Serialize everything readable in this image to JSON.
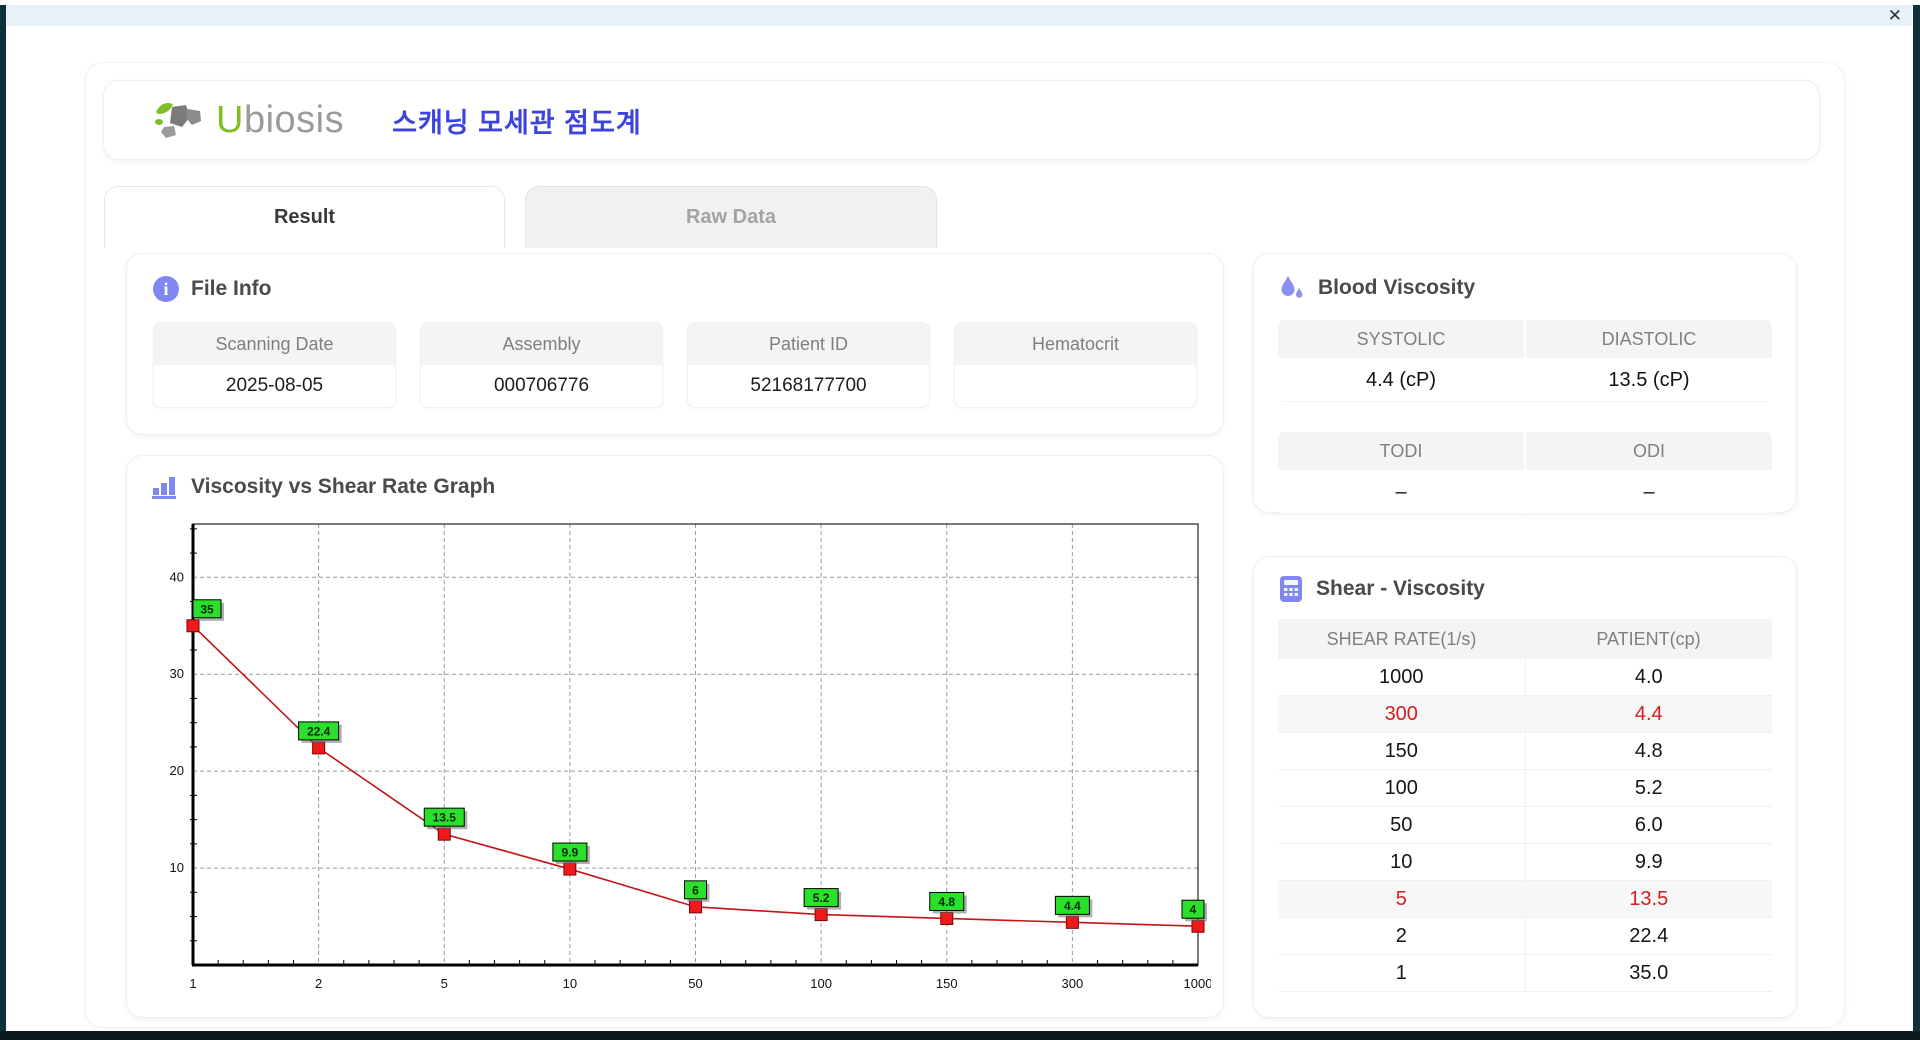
{
  "window": {
    "close_glyph": "✕"
  },
  "header": {
    "brand_u": "U",
    "brand_rest": "biosis",
    "subtitle": "스캐닝 모세관 점도계"
  },
  "tabs": [
    {
      "label": "Result",
      "active": true
    },
    {
      "label": "Raw Data",
      "active": false
    }
  ],
  "file_info": {
    "title": "File Info",
    "fields": [
      {
        "label": "Scanning Date",
        "value": "2025-08-05"
      },
      {
        "label": "Assembly",
        "value": "000706776"
      },
      {
        "label": "Patient ID",
        "value": "52168177700"
      },
      {
        "label": "Hematocrit",
        "value": ""
      }
    ]
  },
  "blood_viscosity": {
    "title": "Blood Viscosity",
    "tables": [
      {
        "headers": [
          "SYSTOLIC",
          "DIASTOLIC"
        ],
        "values": [
          "4.4 (cP)",
          "13.5 (cP)"
        ]
      },
      {
        "headers": [
          "TODI",
          "ODI"
        ],
        "values": [
          "–",
          "–"
        ]
      }
    ]
  },
  "graph": {
    "title": "Viscosity vs Shear Rate Graph"
  },
  "shear_viscosity": {
    "title": "Shear - Viscosity",
    "columns": [
      "SHEAR RATE(1/s)",
      "PATIENT(cp)"
    ],
    "rows": [
      {
        "rate": "1000",
        "value": "4.0",
        "highlight": false
      },
      {
        "rate": "300",
        "value": "4.4",
        "highlight": true
      },
      {
        "rate": "150",
        "value": "4.8",
        "highlight": false
      },
      {
        "rate": "100",
        "value": "5.2",
        "highlight": false
      },
      {
        "rate": "50",
        "value": "6.0",
        "highlight": false
      },
      {
        "rate": "10",
        "value": "9.9",
        "highlight": false
      },
      {
        "rate": "5",
        "value": "13.5",
        "highlight": true
      },
      {
        "rate": "2",
        "value": "22.4",
        "highlight": false
      },
      {
        "rate": "1",
        "value": "35.0",
        "highlight": false
      }
    ]
  },
  "chart_data": {
    "type": "line",
    "title": "Viscosity vs Shear Rate Graph",
    "x_categories": [
      "1",
      "2",
      "5",
      "10",
      "50",
      "100",
      "150",
      "300",
      "1000"
    ],
    "values": [
      35,
      22.4,
      13.5,
      9.9,
      6,
      5.2,
      4.8,
      4.4,
      4.0
    ],
    "point_labels": [
      "35",
      "22.4",
      "13.5",
      "9.9",
      "6",
      "5.2",
      "4.8",
      "4.4",
      "4"
    ],
    "yticks": [
      10,
      20,
      30,
      40
    ],
    "ylim": [
      0,
      45.5
    ],
    "xlabel": "",
    "ylabel": "",
    "grid": "dashed",
    "line_color": "#c41414",
    "marker_color": "#ef1a1a",
    "marker_border": "#7e0000",
    "label_bg": "#2be02b",
    "label_border": "#000000"
  }
}
